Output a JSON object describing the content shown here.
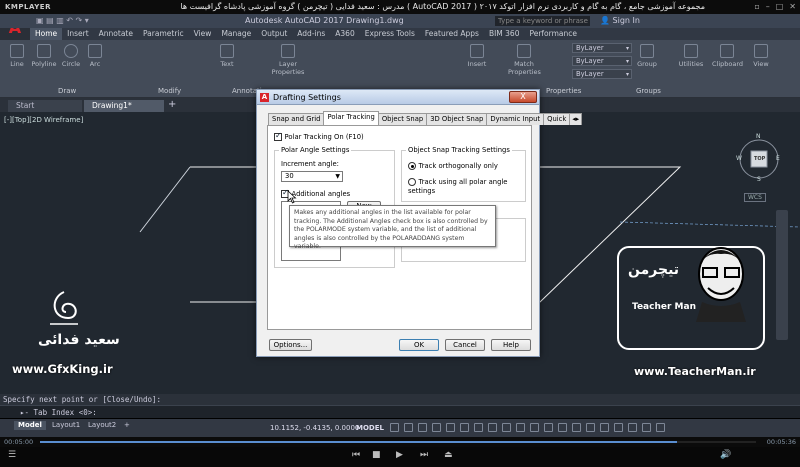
{
  "kmplayer": {
    "logo": "KMPLAYER",
    "title": "مجموعه آموزشی جامع ، گام به گام و کاربردی نرم افزار  اتوکد ۲۰۱۷ ( AutoCAD 2017 )  مدرس : سعید فدایی ( تیچرمن ) گروه آموزشی پادشاه گرافیست ها",
    "time_elapsed": "00:05:00",
    "time_total": "00:05:36",
    "progress": 0.89
  },
  "autocad": {
    "logo_letter": "A",
    "app_title": "Autodesk AutoCAD 2017   Drawing1.dwg",
    "search_placeholder": "Type a keyword or phrase",
    "signin": "Sign In",
    "ribbon_tabs": [
      "Home",
      "Insert",
      "Annotate",
      "Parametric",
      "View",
      "Manage",
      "Output",
      "Add-ins",
      "A360",
      "Express Tools",
      "Featured Apps",
      "BIM 360",
      "Performance"
    ],
    "ribbon_tools": [
      "Line",
      "Polyline",
      "Circle",
      "Arc",
      "Text",
      "Layer Properties",
      "Insert",
      "Match Properties",
      "Group",
      "Utilities",
      "Clipboard",
      "View"
    ],
    "bylayer": "ByLayer",
    "panels": [
      "Draw",
      "Modify",
      "Annotation",
      "Properties",
      "Groups"
    ],
    "file_tabs": [
      "Start",
      "Drawing1*"
    ],
    "viewport_label": "[-][Top][2D Wireframe]",
    "viewcube_top": "TOP",
    "viewcube_dirs": [
      "N",
      "W",
      "E",
      "S"
    ],
    "wcs": "WCS",
    "cmd_history": "Specify next point or [Close/Undo]:",
    "cmd_prompt": "Tab Index <0>:",
    "layout_tabs": [
      "Model",
      "Layout1",
      "Layout2"
    ],
    "coords": "10.1152, -0.4135, 0.0000",
    "model_label": "MODEL"
  },
  "dialog": {
    "title": "Drafting Settings",
    "close": "X",
    "tabs": [
      "Snap and Grid",
      "Polar Tracking",
      "Object Snap",
      "3D Object Snap",
      "Dynamic Input",
      "Quick"
    ],
    "polar_tracking_on": "Polar Tracking On (F10)",
    "polar_angle_settings": "Polar Angle Settings",
    "increment_angle_label": "Increment angle:",
    "increment_angle_value": "30",
    "additional_angles": "Additional angles",
    "new_button": "New",
    "otrack_settings": "Object Snap Tracking Settings",
    "track_ortho": "Track orthogonally only",
    "track_polar": "Track using all polar angle settings",
    "tooltip": "Makes any additional angles in the list available for polar tracking. The Additional Angles check box is also controlled by the POLARMODE system variable, and the list of additional angles is also controlled by the POLARADDANG system variable.",
    "options_button": "Options...",
    "ok_button": "OK",
    "cancel_button": "Cancel",
    "help_button": "Help"
  },
  "watermarks": {
    "left_site": "www.GfxKing.ir",
    "left_name": "سعید فدائی",
    "right_site": "www.TeacherMan.ir",
    "brand_fa": "تیچرمن",
    "brand_en": "Teacher Man"
  }
}
